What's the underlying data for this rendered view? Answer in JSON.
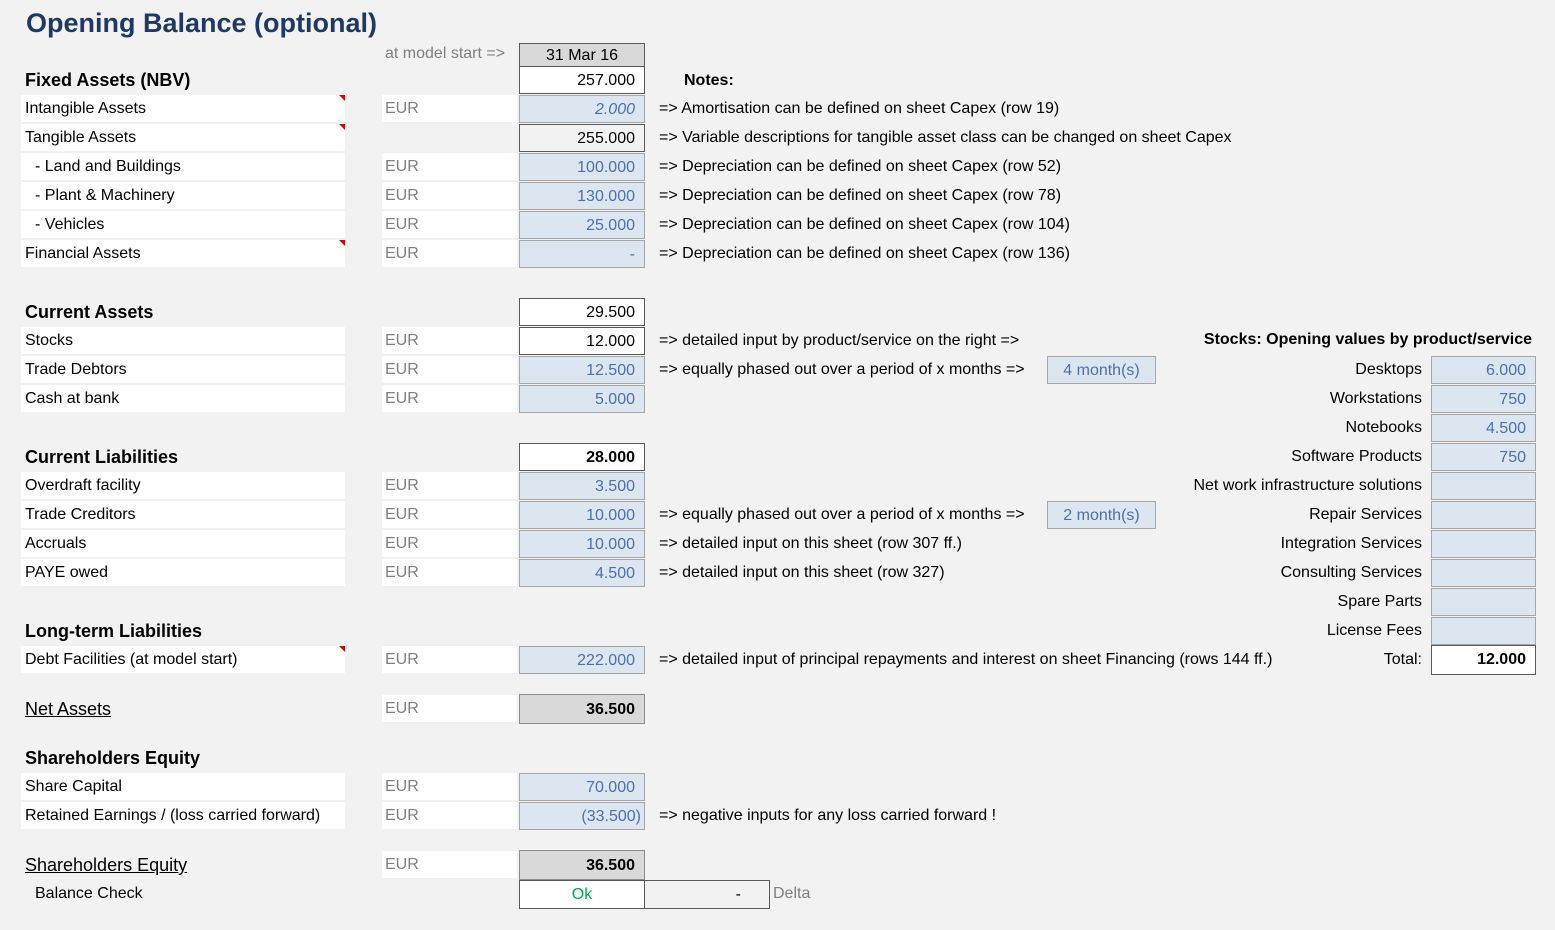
{
  "title": "Opening Balance (optional)",
  "model_start_label": "at model start =>",
  "model_start_date": "31 Mar 16",
  "notes_header": "Notes:",
  "fixed_assets": {
    "header": "Fixed Assets (NBV)",
    "total": "257.000",
    "rows": [
      {
        "label": "Intangible Assets",
        "unit": "EUR",
        "value": "2.000",
        "note": "=> Amortisation can be defined on sheet Capex (row 19)"
      },
      {
        "label": "Tangible Assets",
        "unit": "",
        "value": "255.000",
        "note": "=> Variable descriptions for tangible asset class can be changed on sheet Capex"
      },
      {
        "label": "- Land and Buildings",
        "unit": "EUR",
        "value": "100.000",
        "note": "=> Depreciation can be defined on sheet Capex (row 52)"
      },
      {
        "label": "- Plant & Machinery",
        "unit": "EUR",
        "value": "130.000",
        "note": "=> Depreciation can be defined on sheet Capex (row 78)"
      },
      {
        "label": "- Vehicles",
        "unit": "EUR",
        "value": "25.000",
        "note": "=> Depreciation can be defined on sheet Capex (row 104)"
      },
      {
        "label": "Financial Assets",
        "unit": "EUR",
        "value": "-",
        "note": "=> Depreciation can be defined on sheet Capex (row 136)"
      }
    ]
  },
  "current_assets": {
    "header": "Current Assets",
    "total": "29.500",
    "rows": [
      {
        "label": "Stocks",
        "unit": "EUR",
        "value": "12.000",
        "note": "=> detailed input by product/service on the right =>"
      },
      {
        "label": "Trade Debtors",
        "unit": "EUR",
        "value": "12.500",
        "note": "=> equally phased out over a period of x months =>",
        "months": "4 month(s)"
      },
      {
        "label": "Cash at bank",
        "unit": "EUR",
        "value": "5.000",
        "note": ""
      }
    ]
  },
  "current_liabilities": {
    "header": "Current Liabilities",
    "total": "28.000",
    "rows": [
      {
        "label": "Overdraft facility",
        "unit": "EUR",
        "value": "3.500",
        "note": ""
      },
      {
        "label": "Trade Creditors",
        "unit": "EUR",
        "value": "10.000",
        "note": "=> equally phased out over a period of x months =>",
        "months": "2 month(s)"
      },
      {
        "label": "Accruals",
        "unit": "EUR",
        "value": "10.000",
        "note": "=> detailed input on this sheet (row 307 ff.)"
      },
      {
        "label": "PAYE owed",
        "unit": "EUR",
        "value": "4.500",
        "note": "=> detailed input on this sheet (row 327)"
      }
    ]
  },
  "long_term_liabilities": {
    "header": "Long-term Liabilities",
    "rows": [
      {
        "label": "Debt Facilities (at model start)",
        "unit": "EUR",
        "value": "222.000",
        "note": "=> detailed input of principal repayments and interest on sheet Financing (rows 144 ff.)"
      }
    ]
  },
  "net_assets": {
    "label": "Net Assets",
    "unit": "EUR",
    "value": "36.500"
  },
  "shareholders_equity": {
    "header": "Shareholders Equity",
    "rows": [
      {
        "label": "Share Capital",
        "unit": "EUR",
        "value": "70.000",
        "note": ""
      },
      {
        "label": "Retained Earnings / (loss carried forward)",
        "unit": "EUR",
        "value": "(33.500)",
        "note": "=>  negative inputs for any loss carried forward !"
      }
    ],
    "total_label": "Shareholders Equity",
    "total_unit": "EUR",
    "total_value": "36.500"
  },
  "balance_check": {
    "label": "Balance Check",
    "status": "Ok",
    "delta_value": "-",
    "delta_label": "Delta",
    "status_color": "#00a650"
  },
  "stocks_panel": {
    "header": "Stocks: Opening values by product/service",
    "items": [
      {
        "label": "Desktops",
        "value": "6.000"
      },
      {
        "label": "Workstations",
        "value": "750"
      },
      {
        "label": "Notebooks",
        "value": "4.500"
      },
      {
        "label": "Software Products",
        "value": "750"
      },
      {
        "label": "Net work infrastructure solutions",
        "value": ""
      },
      {
        "label": "Repair Services",
        "value": ""
      },
      {
        "label": "Integration Services",
        "value": ""
      },
      {
        "label": "Consulting Services",
        "value": ""
      },
      {
        "label": "Spare Parts",
        "value": ""
      },
      {
        "label": "License Fees",
        "value": ""
      }
    ],
    "total_label": "Total:",
    "total_value": "12.000"
  },
  "colors": {
    "title": "#1f3864",
    "input_fill": "#dce6f1",
    "input_text": "#4f6fa8"
  }
}
